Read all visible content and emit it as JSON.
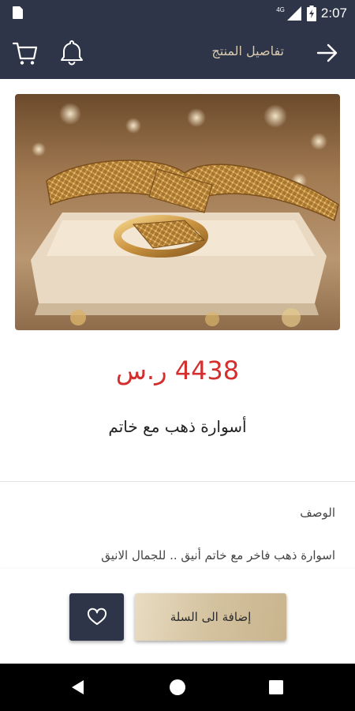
{
  "status_bar": {
    "time": "2:07",
    "network": "4G",
    "icons": [
      "sim-card-icon",
      "signal-icon",
      "battery-icon"
    ]
  },
  "header": {
    "title": "تفاصيل المنتج",
    "icons": [
      "back-arrow-icon",
      "bell-icon",
      "cart-icon"
    ]
  },
  "product": {
    "image_description_icon": "gold-bracelet-photo",
    "price": "4438 ر.س",
    "name": "أسوارة ذهب مع خاتم",
    "description_label": "الوصف",
    "description": "اسوارة ذهب فاخر مع خاتم أنيق .. للجمال الانيق"
  },
  "actions": {
    "add_to_cart": "إضافة الى السلة",
    "favorite_icon": "heart-icon"
  },
  "colors": {
    "primary": "#2f3548",
    "price": "#d32f2f",
    "gold_light": "#e8dcc2",
    "gold_dark": "#c9b48d",
    "title": "#d8cbb0"
  }
}
